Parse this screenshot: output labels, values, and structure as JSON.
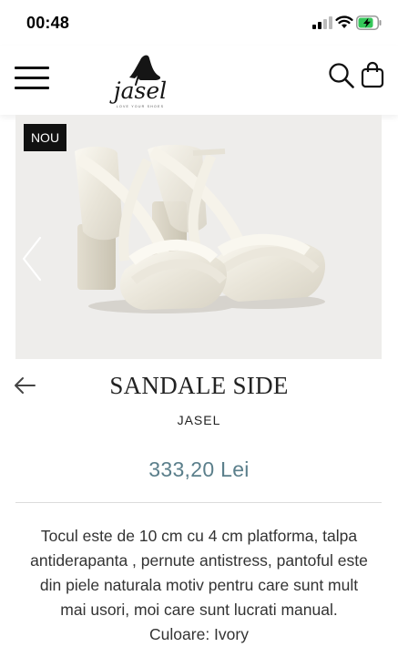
{
  "status_bar": {
    "time": "00:48"
  },
  "header": {
    "logo_text": "jasel",
    "logo_tagline": "LOVE YOUR SHOES"
  },
  "product": {
    "badge": "NOU",
    "title": "SANDALE SIDE",
    "brand": "JASEL",
    "price": "333,20 Lei",
    "description": [
      "Tocul este de 10 cm cu 4 cm platforma, talpa",
      "antiderapanta , pernute antistress, pantoful este",
      "din piele naturala motiv pentru care sunt mult",
      "mai usori, moi care sunt lucrati manual.",
      "Culoare: Ivory"
    ]
  },
  "colors": {
    "price": "#5b7f8b",
    "badge_bg": "#111111",
    "battery": "#34c759"
  },
  "icons": [
    "signal-icon",
    "wifi-icon",
    "battery-charging-icon",
    "menu-icon",
    "search-icon",
    "bag-icon",
    "chevron-left-icon",
    "arrow-left-icon"
  ]
}
